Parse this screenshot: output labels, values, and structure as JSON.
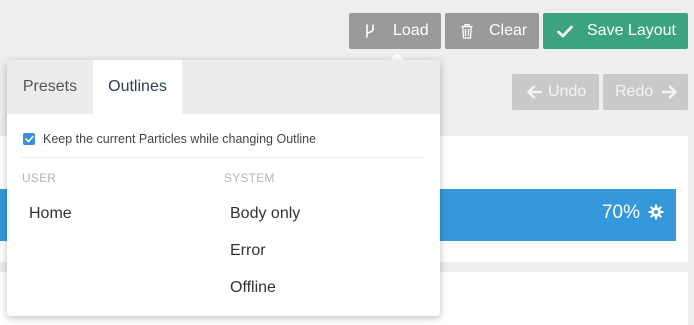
{
  "toolbar": {
    "load_label": "Load",
    "clear_label": "Clear",
    "save_label": "Save Layout",
    "undo_label": "Undo",
    "redo_label": "Redo"
  },
  "row": {
    "percent": "70%"
  },
  "popover": {
    "tabs": [
      {
        "label": "Presets",
        "active": false
      },
      {
        "label": "Outlines",
        "active": true
      }
    ],
    "keep_particles": {
      "label": "Keep the current Particles while changing Outline",
      "checked": true
    },
    "user": {
      "header": "USER",
      "items": [
        "Home"
      ]
    },
    "system": {
      "header": "SYSTEM",
      "items": [
        "Body only",
        "Error",
        "Offline"
      ]
    }
  },
  "colors": {
    "accent_blue": "#3498db",
    "save_green": "#3ba47f",
    "button_gray": "#9a9a9a",
    "disabled_gray": "#c9c9c9"
  },
  "icons": {
    "load": "branch-icon",
    "clear": "trash-icon",
    "save": "check-icon",
    "undo": "arrow-left-icon",
    "redo": "arrow-right-icon",
    "settings": "gear-icon"
  }
}
